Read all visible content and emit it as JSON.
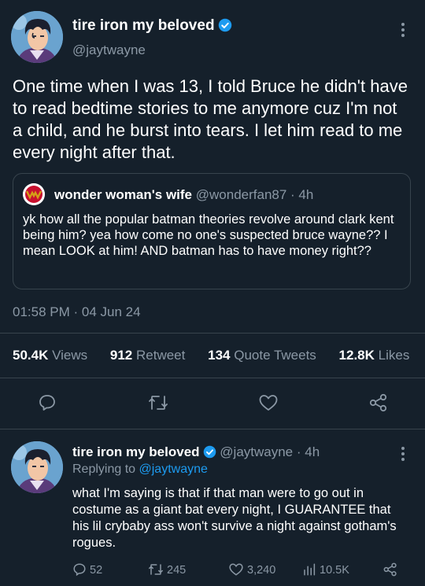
{
  "main_tweet": {
    "display_name": "tire iron my beloved",
    "handle": "@jaytwayne",
    "text": "One time when I was 13, I told Bruce he didn't have to read bedtime stories to me anymore cuz I'm not a child, and he burst into tears. I let him read to me every night after that.",
    "timestamp": "01:58 PM · 04 Jun 24"
  },
  "quoted_tweet": {
    "display_name": "wonder woman's wife",
    "handle": "@wonderfan87",
    "time": "· 4h",
    "text": "yk how all the popular batman theories revolve around clark kent being him? yea how come no one's suspected bruce wayne?? I mean LOOK at him! AND batman has to have money right??"
  },
  "stats": {
    "views_count": "50.4K",
    "views_label": "Views",
    "retweets_count": "912",
    "retweets_label": "Retweet",
    "quotes_count": "134",
    "quotes_label": "Quote Tweets",
    "likes_count": "12.8K",
    "likes_label": "Likes"
  },
  "reply_tweet": {
    "display_name": "tire iron my beloved",
    "handle_time": "@jaytwayne · 4h",
    "replying_prefix": "Replying to",
    "replying_handle": "@jaytwayne",
    "text": "what I'm saying is that if that man were to go out in costume as a giant bat every night, I GUARANTEE that his lil crybaby ass won't survive a night against gotham's rogues.",
    "replies": "52",
    "retweets": "245",
    "likes": "3,240",
    "views": "10.5K"
  },
  "icons": {
    "verified": "verified-badge-icon",
    "more": "more-vertical-icon",
    "reply": "reply-icon",
    "retweet": "retweet-icon",
    "like": "heart-icon",
    "share": "share-icon",
    "views": "views-bar-chart-icon"
  },
  "colors": {
    "background": "#15202b",
    "accent": "#1d9bf0",
    "muted": "#8b98a5",
    "divider": "#38444d"
  }
}
